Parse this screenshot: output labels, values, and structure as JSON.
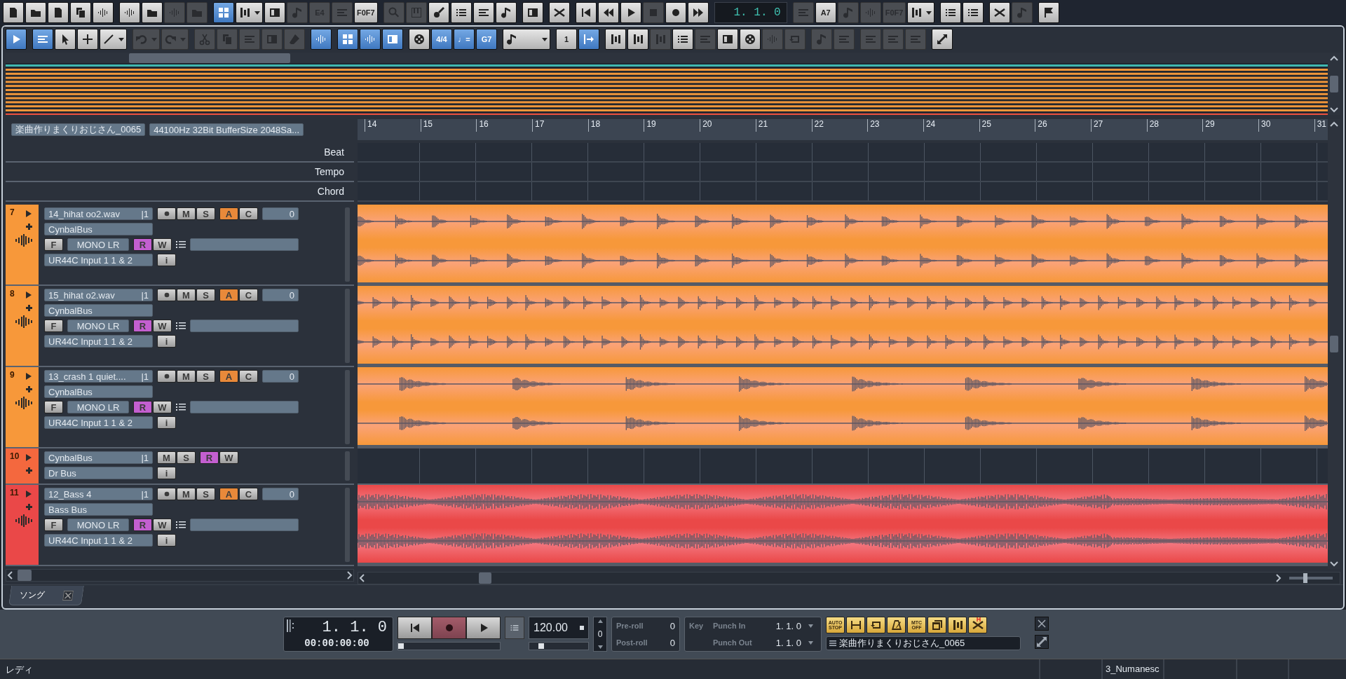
{
  "toolbar": {
    "left_groups": [
      [
        {
          "on": false,
          "disabled": false,
          "dropdown": false
        },
        {
          "on": false,
          "disabled": false,
          "dropdown": false
        },
        {
          "on": false,
          "disabled": false,
          "dropdown": false
        },
        {
          "on": false,
          "disabled": false,
          "dropdown": false
        },
        {
          "on": false,
          "disabled": false,
          "dropdown": false
        }
      ],
      [
        {
          "on": false,
          "disabled": false,
          "dropdown": false
        },
        {
          "on": false,
          "disabled": false,
          "dropdown": false
        },
        {
          "on": false,
          "disabled": true,
          "dropdown": false
        },
        {
          "on": false,
          "disabled": true,
          "dropdown": false
        }
      ],
      [
        {
          "on": true,
          "disabled": false,
          "dropdown": false
        },
        {
          "on": false,
          "disabled": false,
          "dropdown": true
        },
        {
          "on": false,
          "disabled": false,
          "dropdown": false
        },
        {
          "on": false,
          "disabled": true,
          "dropdown": false
        },
        {
          "on": false,
          "disabled": true,
          "dropdown": false,
          "label": "E4"
        },
        {
          "on": false,
          "disabled": true,
          "dropdown": false
        },
        {
          "on": false,
          "disabled": false,
          "dropdown": false,
          "label": "F0F7"
        }
      ],
      [
        {
          "on": false,
          "disabled": true,
          "dropdown": false
        },
        {
          "on": false,
          "disabled": true,
          "dropdown": false
        },
        {
          "on": false,
          "disabled": false,
          "dropdown": false
        },
        {
          "on": false,
          "disabled": false,
          "dropdown": false
        },
        {
          "on": false,
          "disabled": false,
          "dropdown": false
        },
        {
          "on": false,
          "disabled": false,
          "dropdown": false
        }
      ],
      [
        {
          "on": false,
          "disabled": false,
          "dropdown": false
        }
      ],
      [
        {
          "on": false,
          "disabled": false,
          "dropdown": false
        }
      ],
      [
        {
          "on": false,
          "disabled": false,
          "dropdown": false
        },
        {
          "on": false,
          "disabled": false,
          "dropdown": false
        },
        {
          "on": false,
          "disabled": false,
          "dropdown": false
        },
        {
          "on": false,
          "disabled": true,
          "dropdown": false
        },
        {
          "on": false,
          "disabled": false,
          "dropdown": false
        },
        {
          "on": false,
          "disabled": false,
          "dropdown": false
        }
      ]
    ],
    "counter": "1. 1. 0",
    "right_groups": [
      [
        {
          "on": false,
          "disabled": true,
          "dropdown": false
        },
        {
          "on": false,
          "disabled": false,
          "dropdown": false,
          "label": "A7"
        },
        {
          "on": false,
          "disabled": true,
          "dropdown": false
        },
        {
          "on": false,
          "disabled": true,
          "dropdown": false
        },
        {
          "on": false,
          "disabled": true,
          "dropdown": false,
          "label": "F0F7"
        },
        {
          "on": false,
          "disabled": false,
          "dropdown": true
        }
      ],
      [
        {
          "on": false,
          "disabled": false,
          "dropdown": false
        },
        {
          "on": false,
          "disabled": false,
          "dropdown": false
        }
      ],
      [
        {
          "on": false,
          "disabled": false,
          "dropdown": false
        },
        {
          "on": false,
          "disabled": true,
          "dropdown": false
        }
      ],
      [
        {
          "on": false,
          "disabled": false,
          "dropdown": false
        }
      ]
    ]
  },
  "edit_toolbar": {
    "groups": [
      [
        {
          "on": true,
          "disabled": false,
          "dropdown": false
        }
      ],
      [
        {
          "on": true,
          "disabled": false,
          "dropdown": false
        },
        {
          "on": false,
          "disabled": false,
          "dropdown": false
        },
        {
          "on": false,
          "disabled": false,
          "dropdown": false
        },
        {
          "on": false,
          "disabled": false,
          "dropdown": true
        }
      ],
      [
        {
          "on": false,
          "disabled": true,
          "dropdown": true
        },
        {
          "on": false,
          "disabled": true,
          "dropdown": true
        }
      ],
      [
        {
          "on": false,
          "disabled": true,
          "dropdown": false
        },
        {
          "on": false,
          "disabled": true,
          "dropdown": false
        },
        {
          "on": false,
          "disabled": true,
          "dropdown": false
        },
        {
          "on": false,
          "disabled": true,
          "dropdown": false
        },
        {
          "on": false,
          "disabled": true,
          "dropdown": false
        }
      ],
      [
        {
          "on": true,
          "disabled": false,
          "dropdown": false
        }
      ],
      [
        {
          "on": true,
          "disabled": false,
          "dropdown": false
        },
        {
          "on": true,
          "disabled": false,
          "dropdown": false
        },
        {
          "on": true,
          "disabled": false,
          "dropdown": false
        }
      ],
      [
        {
          "on": false,
          "disabled": false,
          "dropdown": false
        },
        {
          "on": true,
          "disabled": false,
          "dropdown": false,
          "label": "4/4"
        },
        {
          "on": true,
          "disabled": false,
          "dropdown": false,
          "label": "♩="
        },
        {
          "on": true,
          "disabled": false,
          "dropdown": false,
          "label": "G7"
        }
      ],
      [
        {
          "on": false,
          "disabled": false,
          "dropdown": true
        }
      ],
      [
        {
          "on": false,
          "disabled": false,
          "dropdown": false,
          "label": "1"
        },
        {
          "on": true,
          "disabled": false,
          "dropdown": false
        }
      ],
      [
        {
          "on": false,
          "disabled": false,
          "dropdown": false
        },
        {
          "on": false,
          "disabled": false,
          "dropdown": false
        },
        {
          "on": false,
          "disabled": true,
          "dropdown": false
        },
        {
          "on": false,
          "disabled": false,
          "dropdown": false
        },
        {
          "on": false,
          "disabled": true,
          "dropdown": false
        },
        {
          "on": false,
          "disabled": false,
          "dropdown": false
        },
        {
          "on": false,
          "disabled": false,
          "dropdown": false
        },
        {
          "on": false,
          "disabled": true,
          "dropdown": false
        },
        {
          "on": false,
          "disabled": true,
          "dropdown": false
        }
      ],
      [
        {
          "on": false,
          "disabled": true,
          "dropdown": false
        },
        {
          "on": false,
          "disabled": true,
          "dropdown": false
        }
      ],
      [
        {
          "on": false,
          "disabled": true,
          "dropdown": false
        },
        {
          "on": false,
          "disabled": true,
          "dropdown": false
        },
        {
          "on": false,
          "disabled": true,
          "dropdown": false
        }
      ],
      [
        {
          "on": false,
          "disabled": false,
          "dropdown": false
        }
      ]
    ]
  },
  "song_info": {
    "title": "楽曲作りまくりおじさん_0065",
    "audio": "44100Hz 32Bit BufferSize 2048Sa..."
  },
  "ruler": [
    "14",
    "15",
    "16",
    "17",
    "18",
    "19",
    "20",
    "21",
    "22",
    "23",
    "24",
    "25",
    "26",
    "27",
    "28",
    "29",
    "30",
    "31"
  ],
  "global_tracks": [
    "Beat",
    "Tempo",
    "Chord"
  ],
  "tracks": [
    {
      "number": "7",
      "color": "#f7983a",
      "kind": "audio",
      "name": "14_hihat oo2.wav",
      "channel": "|1",
      "record": {
        "on": false
      },
      "mute": {
        "label": "M",
        "on": false
      },
      "solo": {
        "label": "S",
        "on": false
      },
      "auto": {
        "label": "A",
        "on": true
      },
      "chord": {
        "label": "C",
        "on": false
      },
      "volume": "0",
      "bus": "CynbalBus",
      "freeze": {
        "label": "F",
        "on": false
      },
      "output": "MONO LR",
      "read": {
        "label": "R",
        "on": true
      },
      "write": {
        "label": "W",
        "on": false
      },
      "input": "UR44C Input 1 1 & 2",
      "info": "i"
    },
    {
      "number": "8",
      "color": "#f7983a",
      "kind": "audio",
      "name": "15_hihat o2.wav",
      "channel": "|1",
      "record": {
        "on": false
      },
      "mute": {
        "label": "M",
        "on": false
      },
      "solo": {
        "label": "S",
        "on": false
      },
      "auto": {
        "label": "A",
        "on": true
      },
      "chord": {
        "label": "C",
        "on": false
      },
      "volume": "0",
      "bus": "CynbalBus",
      "freeze": {
        "label": "F",
        "on": false
      },
      "output": "MONO LR",
      "read": {
        "label": "R",
        "on": true
      },
      "write": {
        "label": "W",
        "on": false
      },
      "input": "UR44C Input 1 1 & 2",
      "info": "i"
    },
    {
      "number": "9",
      "color": "#f7983a",
      "kind": "audio",
      "name": "13_crash 1 quiet....",
      "channel": "|1",
      "record": {
        "on": false
      },
      "mute": {
        "label": "M",
        "on": false
      },
      "solo": {
        "label": "S",
        "on": false
      },
      "auto": {
        "label": "A",
        "on": true
      },
      "chord": {
        "label": "C",
        "on": false
      },
      "volume": "0",
      "bus": "CynbalBus",
      "freeze": {
        "label": "F",
        "on": false
      },
      "output": "MONO LR",
      "read": {
        "label": "R",
        "on": true
      },
      "write": {
        "label": "W",
        "on": false
      },
      "input": "UR44C Input 1 1 & 2",
      "info": "i"
    },
    {
      "number": "10",
      "color": "#f4683e",
      "kind": "bus",
      "name": "CynbalBus",
      "channel": "|1",
      "mute": {
        "label": "M",
        "on": false
      },
      "solo": {
        "label": "S",
        "on": false
      },
      "read": {
        "label": "R",
        "on": true
      },
      "write": {
        "label": "W",
        "on": false
      },
      "bus": "Dr Bus",
      "info": "i"
    },
    {
      "number": "11",
      "color": "#ea4848",
      "kind": "audio",
      "name": "12_Bass 4",
      "channel": "|1",
      "record": {
        "on": false
      },
      "mute": {
        "label": "M",
        "on": false
      },
      "solo": {
        "label": "S",
        "on": false
      },
      "auto": {
        "label": "A",
        "on": true
      },
      "chord": {
        "label": "C",
        "on": false
      },
      "volume": "0",
      "bus": "Bass Bus",
      "freeze": {
        "label": "F",
        "on": false
      },
      "output": "MONO LR",
      "read": {
        "label": "R",
        "on": true
      },
      "write": {
        "label": "W",
        "on": false
      },
      "input": "UR44C Input 1 1 & 2",
      "info": "i"
    }
  ],
  "zoom_slider": {
    "level": 0.36
  },
  "song_tab": {
    "label": "ソング"
  },
  "transport": {
    "position": "1. 1. 0",
    "timecode": "00:00:00:00",
    "buttons": [
      {
        "kind": "rewind"
      },
      {
        "kind": "record"
      },
      {
        "kind": "play"
      }
    ],
    "position_slider": {
      "level": 0.03
    },
    "tempo": "120.00",
    "tempo_slider": {
      "level": 0.2
    },
    "shift": "0",
    "pre_roll": {
      "label": "Pre-roll",
      "value": "0"
    },
    "post_roll": {
      "label": "Post-roll",
      "value": "0"
    },
    "key": "Key",
    "punch_in": {
      "label": "Punch In",
      "value": "1. 1. 0"
    },
    "punch_out": {
      "label": "Punch Out",
      "value": "1. 1. 0"
    },
    "toggles": [
      {
        "label": "AUTO STOP",
        "on": true
      },
      {
        "on": true
      },
      {
        "on": true
      },
      {
        "on": true
      },
      {
        "label": "MTC OFF",
        "on": true
      },
      {
        "on": true
      },
      {
        "on": true
      },
      {
        "on": true,
        "badge": "H"
      }
    ],
    "song_field": "楽曲作りまくりおじさん_0065"
  },
  "status_bar": {
    "message": "レディ",
    "panes": [
      "3_Numanesc"
    ]
  }
}
